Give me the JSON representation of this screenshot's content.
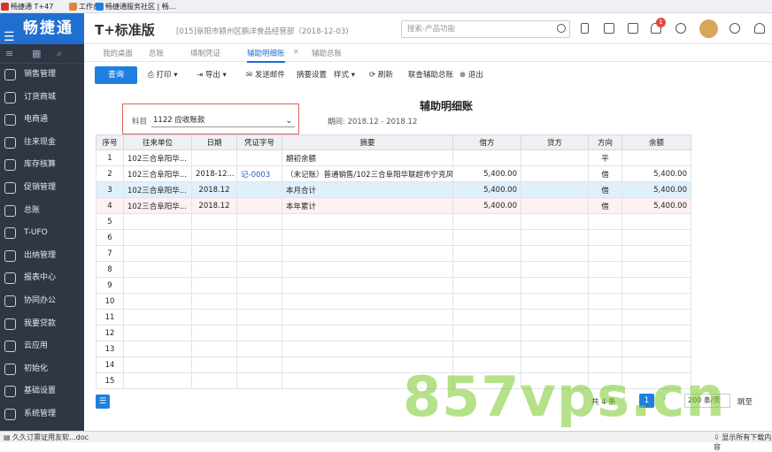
{
  "browser_tabs": [
    {
      "label": "畅捷通 T+47",
      "color": "#d9342b"
    },
    {
      "label": "工作台",
      "color": "#e1843a"
    },
    {
      "label": "畅捷通服务社区 | 畅...",
      "color": "#1f7fe0"
    }
  ],
  "app": {
    "logo": "畅捷通",
    "brand": "T+标准版",
    "company": "[015]阜阳市颍州区鹏洋食品经营部（2018-12-03)",
    "search_placeholder": "搜索-产品功能",
    "notification_count": "1"
  },
  "sidebar": {
    "items": [
      {
        "label": "销售管理",
        "icon": "sales-icon"
      },
      {
        "label": "订货商城",
        "icon": "mall-icon"
      },
      {
        "label": "电商通",
        "icon": "ecommerce-icon"
      },
      {
        "label": "往来现金",
        "icon": "cash-icon"
      },
      {
        "label": "库存核算",
        "icon": "inventory-icon"
      },
      {
        "label": "促销管理",
        "icon": "promotion-icon"
      },
      {
        "label": "总账",
        "icon": "ledger-icon"
      },
      {
        "label": "T-UFO",
        "icon": "ufo-icon"
      },
      {
        "label": "出纳管理",
        "icon": "cashier-icon"
      },
      {
        "label": "报表中心",
        "icon": "report-icon"
      },
      {
        "label": "协同办公",
        "icon": "office-icon"
      },
      {
        "label": "我要贷款",
        "icon": "loan-icon"
      },
      {
        "label": "云应用",
        "icon": "cloud-icon"
      },
      {
        "label": "初始化",
        "icon": "init-icon"
      },
      {
        "label": "基础设置",
        "icon": "settings-icon"
      },
      {
        "label": "系统管理",
        "icon": "system-icon"
      }
    ]
  },
  "subtabs": [
    "我的桌面",
    "总账",
    "填制凭证",
    "辅助明细账",
    "辅助总账"
  ],
  "active_tab": "辅助明细账",
  "toolbar": {
    "query": "查询",
    "print": "打印",
    "export": "导出",
    "email": "发送邮件",
    "summary": "摘要设置",
    "style": "样式",
    "refresh": "刷新",
    "link": "联查辅助总账",
    "exit": "退出"
  },
  "report": {
    "title": "辅助明细账",
    "subject_label": "科目",
    "subject_value": "1122 应收账款",
    "period_label": "期间:",
    "period_value": "2018.12 - 2018.12"
  },
  "table": {
    "columns": [
      "序号",
      "往来单位",
      "日期",
      "凭证字号",
      "摘要",
      "借方",
      "贷方",
      "方向",
      "余额"
    ],
    "rows": [
      [
        "1",
        "102三合阜阳华...",
        "",
        "",
        "期初余额",
        "",
        "",
        "平",
        ""
      ],
      [
        "2",
        "102三合阜阳华...",
        "2018-12...",
        "记-0003",
        "（未记账）普通销售/102三合阜阳华联超市宁克风",
        "5,400.00",
        "",
        "借",
        "5,400.00"
      ],
      [
        "3",
        "102三合阜阳华...",
        "2018.12",
        "",
        "本月合计",
        "5,400.00",
        "",
        "借",
        "5,400.00"
      ],
      [
        "4",
        "102三合阜阳华...",
        "2018.12",
        "",
        "本年累计",
        "5,400.00",
        "",
        "借",
        "5,400.00"
      ],
      [
        "5",
        "",
        "",
        "",
        "",
        "",
        "",
        "",
        ""
      ],
      [
        "6",
        "",
        "",
        "",
        "",
        "",
        "",
        "",
        ""
      ],
      [
        "7",
        "",
        "",
        "",
        "",
        "",
        "",
        "",
        ""
      ],
      [
        "8",
        "",
        "",
        "",
        "",
        "",
        "",
        "",
        ""
      ],
      [
        "9",
        "",
        "",
        "",
        "",
        "",
        "",
        "",
        ""
      ],
      [
        "10",
        "",
        "",
        "",
        "",
        "",
        "",
        "",
        ""
      ],
      [
        "11",
        "",
        "",
        "",
        "",
        "",
        "",
        "",
        ""
      ],
      [
        "12",
        "",
        "",
        "",
        "",
        "",
        "",
        "",
        ""
      ],
      [
        "13",
        "",
        "",
        "",
        "",
        "",
        "",
        "",
        ""
      ],
      [
        "14",
        "",
        "",
        "",
        "",
        "",
        "",
        "",
        ""
      ],
      [
        "15",
        "",
        "",
        "",
        "",
        "",
        "",
        "",
        ""
      ]
    ]
  },
  "pager": {
    "total": "共 4 条",
    "page": "1",
    "page_size": "200 条/页",
    "jump": "跳至"
  },
  "bottom": {
    "download": "久久订票证用友软...doc",
    "show_all": "显示所有下载内容"
  },
  "watermark": "857vps.cn"
}
